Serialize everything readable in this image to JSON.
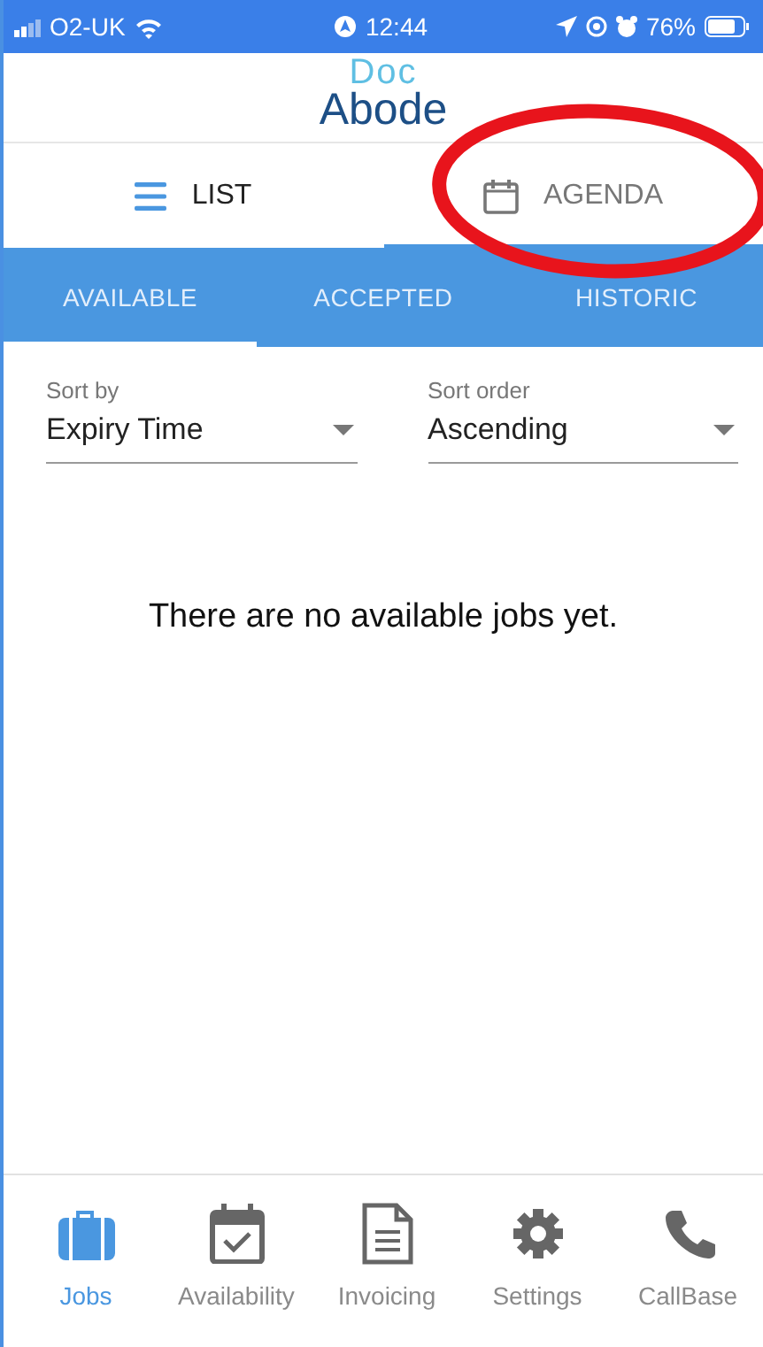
{
  "status_bar": {
    "carrier": "O2-UK",
    "time": "12:44",
    "battery": "76%"
  },
  "logo": {
    "top": "Doc",
    "bottom": "Abode"
  },
  "view_tabs": [
    {
      "label": "LIST",
      "selected": true
    },
    {
      "label": "AGENDA",
      "selected": false
    }
  ],
  "job_tabs": [
    {
      "label": "AVAILABLE",
      "selected": true
    },
    {
      "label": "ACCEPTED",
      "selected": false
    },
    {
      "label": "HISTORIC",
      "selected": false
    }
  ],
  "sort_fields": [
    {
      "label": "Sort by",
      "value": "Expiry Time"
    },
    {
      "label": "Sort order",
      "value": "Ascending"
    }
  ],
  "message": "There are no available jobs yet.",
  "bottom_nav": [
    {
      "label": "Jobs",
      "selected": true
    },
    {
      "label": "Availability",
      "selected": false
    },
    {
      "label": "Invoicing",
      "selected": false
    },
    {
      "label": "Settings",
      "selected": false
    },
    {
      "label": "CallBase",
      "selected": false
    }
  ],
  "annotation": {
    "kind": "ellipse",
    "color": "#e8141c"
  }
}
